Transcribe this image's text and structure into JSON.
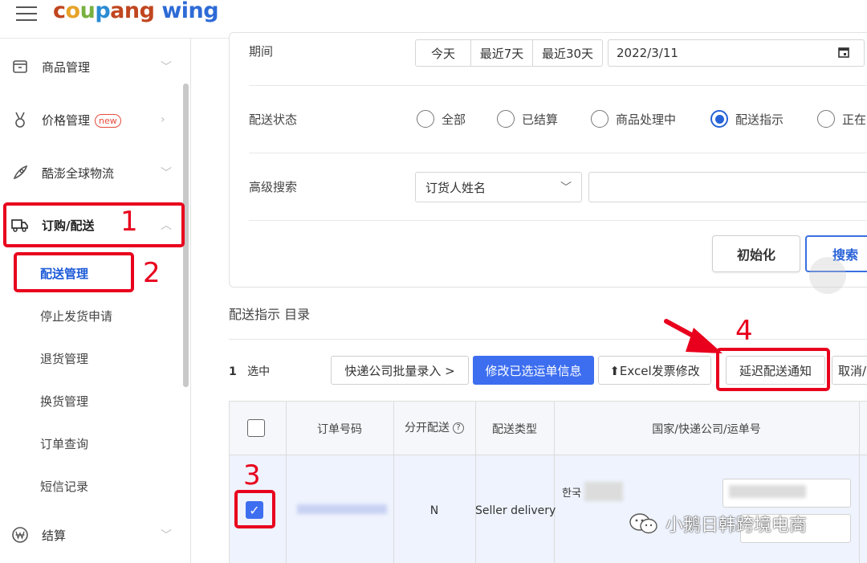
{
  "header": {
    "logo_parts": [
      "c",
      "o",
      "u",
      "p",
      "ang"
    ],
    "logo_word": "coupang",
    "logo_wing": "wing"
  },
  "sidebar": {
    "items": [
      {
        "label": "商品管理",
        "icon": "box-icon"
      },
      {
        "label": "价格管理",
        "badge": "new",
        "icon": "medal-icon"
      },
      {
        "label": "酷澎全球物流",
        "icon": "rocket-icon"
      },
      {
        "label": "订购/配送",
        "icon": "truck-icon"
      },
      {
        "label": "结算",
        "icon": "won-icon"
      }
    ],
    "sub_items": [
      "配送管理",
      "停止发货申请",
      "退货管理",
      "换货管理",
      "订单查询",
      "短信记录"
    ]
  },
  "annotations": [
    "1",
    "2",
    "3",
    "4"
  ],
  "filters": {
    "period_label": "期间",
    "period_buttons": [
      "今天",
      "最近7天",
      "最近30天"
    ],
    "date_value": "2022/3/11",
    "status_label": "配送状态",
    "status_options": [
      "全部",
      "已结算",
      "商品处理中",
      "配送指示",
      "正在"
    ],
    "status_selected": 3,
    "advanced_label": "高级搜索",
    "advanced_select": "订货人姓名",
    "reset_label": "初始化",
    "search_label": "搜索"
  },
  "list": {
    "title": "配送指示 目录",
    "selected_count": "1",
    "selected_text": "选中",
    "actions": [
      "快递公司批量录入 >",
      "修改已选运单信息",
      "⬆Excel发票修改",
      "延迟配送通知",
      "取消/"
    ],
    "columns": [
      "订单号码",
      "分开配送",
      "配送类型",
      "国家/快递公司/运单号"
    ],
    "row": {
      "split": "N",
      "delivery_type": "Seller delivery",
      "country_prefix": "한국"
    }
  },
  "watermark": "小鹅日韩跨境电商",
  "colors": {
    "accent": "#3d6ef0",
    "annotation": "#e8001d"
  }
}
